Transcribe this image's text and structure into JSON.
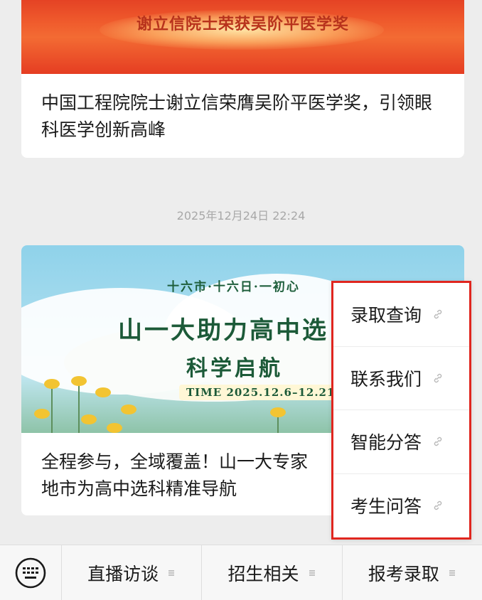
{
  "articles": [
    {
      "banner_text": "谢立信院士荣获吴阶平医学奖",
      "title": "中国工程院院士谢立信荣膺吴阶平医学奖，引领眼科医学创新高峰"
    },
    {
      "banner_sub": "十六市·十六日·一初心",
      "banner_title_line1": "山一大助力高中选",
      "banner_title_line2": "科学启航",
      "banner_time": "TIME  2025.12.6–12.21",
      "title": "全程参与，全域覆盖！山一大专家",
      "title_line2": "地市为高中选科精准导航"
    }
  ],
  "timestamp": "2025年12月24日 22:24",
  "popup_menu": {
    "items": [
      {
        "label": "录取查询",
        "icon": "link-icon"
      },
      {
        "label": "联系我们",
        "icon": "link-icon"
      },
      {
        "label": "智能分答",
        "icon": "link-icon"
      },
      {
        "label": "考生问答",
        "icon": "link-icon"
      }
    ],
    "highlight_color": "#e0261f"
  },
  "bottom_bar": {
    "keyboard_icon": "keyboard-icon",
    "tabs": [
      {
        "label": "直播访谈",
        "icon": "menu-lines-icon"
      },
      {
        "label": "招生相关",
        "icon": "menu-lines-icon"
      },
      {
        "label": "报考录取",
        "icon": "menu-lines-icon"
      }
    ]
  }
}
